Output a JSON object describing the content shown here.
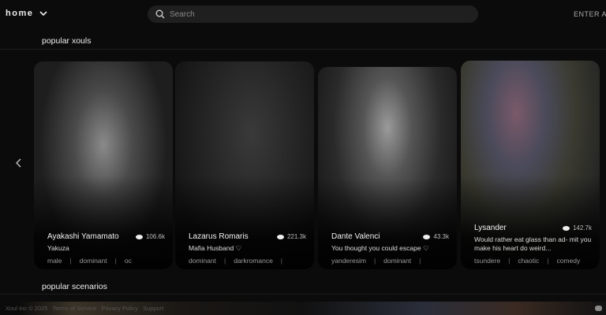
{
  "header": {
    "home_label": "home",
    "search_placeholder": "Search",
    "enter_label": "ENTER A"
  },
  "sections": {
    "popular_xouls": "popular xouls",
    "popular_scenarios": "popular scenarios"
  },
  "cards": [
    {
      "name": "Ayakashi Yamamato",
      "count": "106.6k",
      "desc": "Yakuza",
      "tags": [
        "male",
        "dominant",
        "oc"
      ]
    },
    {
      "name": "Lazarus Romaris",
      "count": "221.3k",
      "desc": "Mafia Husband ♡",
      "tags": [
        "dominant",
        "darkromance"
      ]
    },
    {
      "name": "Dante Valenci",
      "count": "43.3k",
      "desc": "You thought you could escape ♡",
      "tags": [
        "yanderesim",
        "dominant"
      ]
    },
    {
      "name": "Lysander",
      "count": "142.7k",
      "desc": "Would rather eat glass than ad- mit you make his heart do weird...",
      "tags": [
        "tsundere",
        "chaotic",
        "comedy"
      ]
    }
  ],
  "footer": {
    "copyright": "Xoul Inc © 2025",
    "links": [
      "Terms of Service",
      "Privacy Policy",
      "Support"
    ]
  }
}
